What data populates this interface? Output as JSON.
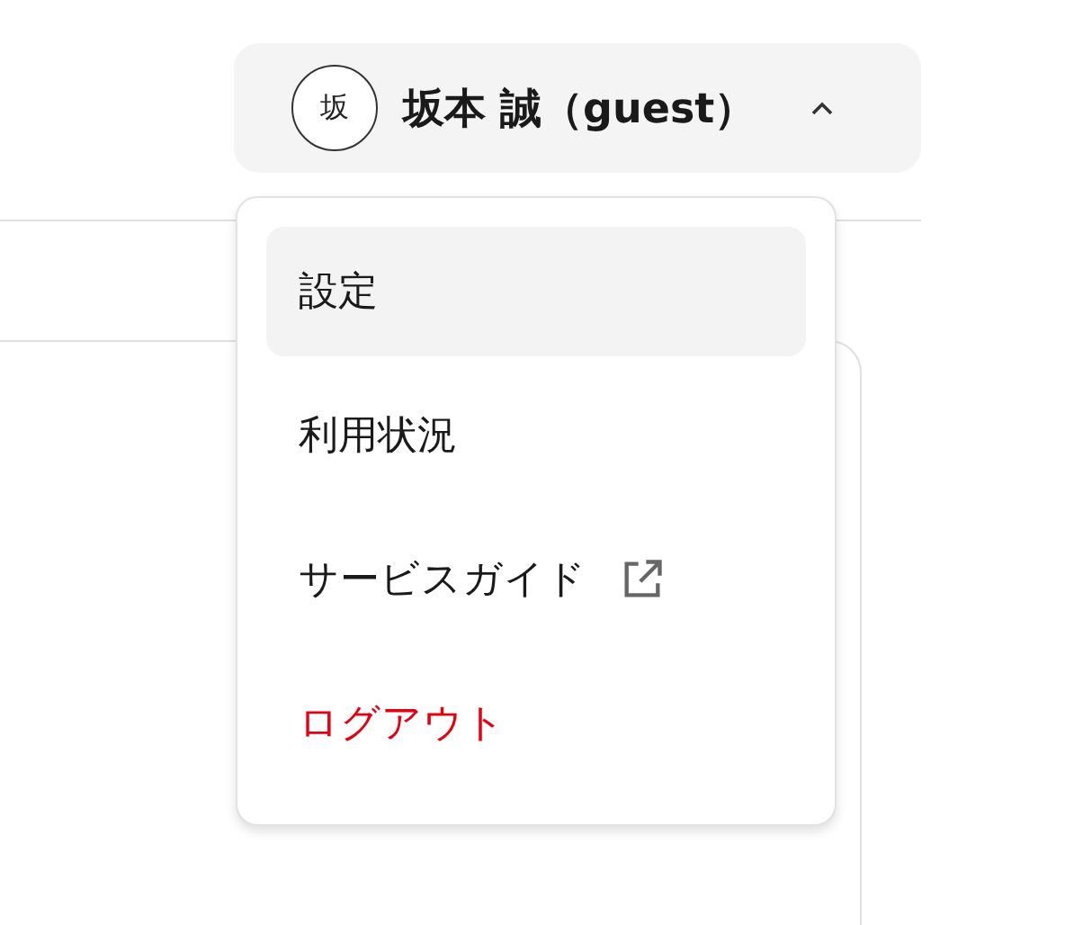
{
  "user_button": {
    "avatar": "坂",
    "name": "坂本 誠（guest）",
    "expanded": true
  },
  "menu": {
    "items": [
      {
        "label": "設定",
        "kind": "normal",
        "selected": true
      },
      {
        "label": "利用状況",
        "kind": "normal",
        "selected": false
      },
      {
        "label": "サービスガイド",
        "kind": "external",
        "selected": false
      },
      {
        "label": "ログアウト",
        "kind": "danger",
        "selected": false
      }
    ]
  }
}
